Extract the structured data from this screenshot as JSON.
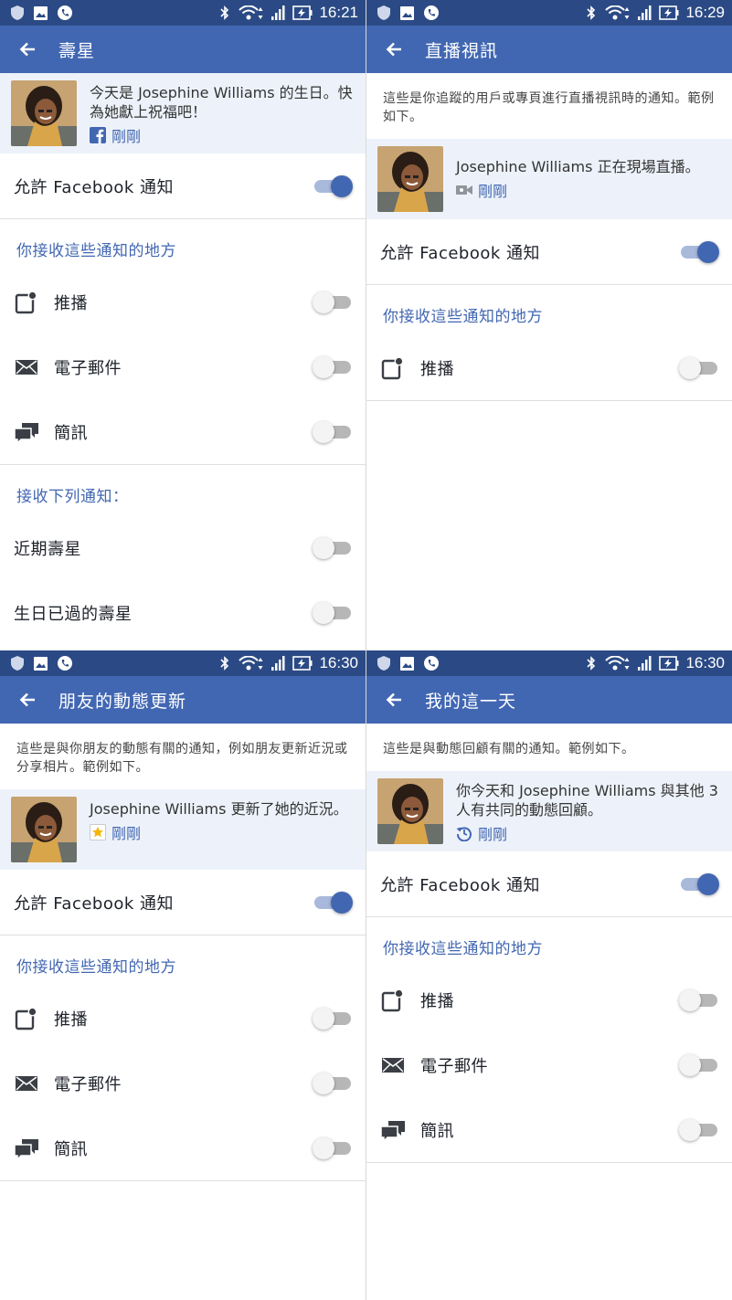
{
  "status": {
    "panels": [
      "16:21",
      "16:29",
      "16:30",
      "16:30"
    ]
  },
  "panels": [
    {
      "title": "壽星",
      "example_text": "今天是 Josephine Williams 的生日。快為她獻上祝福吧！",
      "example_time": "剛剛",
      "allow_label": "允許 Facebook 通知",
      "section_where": "你接收這些通知的地方",
      "push_label": "推播",
      "email_label": "電子郵件",
      "sms_label": "簡訊",
      "section_receive": "接收下列通知：",
      "recent_label": "近期壽星",
      "past_label": "生日已過的壽星"
    },
    {
      "title": "直播視訊",
      "description": "這些是你追蹤的用戶或專頁進行直播視訊時的通知。範例如下。",
      "example_text": "Josephine Williams 正在現場直播。",
      "example_time": "剛剛",
      "allow_label": "允許 Facebook 通知",
      "section_where": "你接收這些通知的地方",
      "push_label": "推播"
    },
    {
      "title": "朋友的動態更新",
      "description": "這些是與你朋友的動態有關的通知，例如朋友更新近況或分享相片。範例如下。",
      "example_text": "Josephine Williams 更新了她的近況。",
      "example_time": "剛剛",
      "allow_label": "允許 Facebook 通知",
      "section_where": "你接收這些通知的地方",
      "push_label": "推播",
      "email_label": "電子郵件",
      "sms_label": "簡訊"
    },
    {
      "title": "我的這一天",
      "description": "這些是與動態回顧有關的通知。範例如下。",
      "example_text": "你今天和 Josephine Williams 與其他 3 人有共同的動態回顧。",
      "example_time": "剛剛",
      "allow_label": "允許 Facebook 通知",
      "section_where": "你接收這些通知的地方",
      "push_label": "推播",
      "email_label": "電子郵件",
      "sms_label": "簡訊"
    }
  ],
  "toggles": {
    "allow_facebook": "on",
    "push": "off",
    "email": "off",
    "sms": "off",
    "recent_birthdays": "off",
    "past_birthdays": "off"
  },
  "colors": {
    "status_bar": "#2b4a85",
    "app_bar": "#4267b2",
    "example_bg": "#edf2fa",
    "accent": "#4267b2"
  },
  "icons": {
    "back": "arrow-left-icon",
    "push": "push-notification-icon",
    "email": "envelope-icon",
    "sms": "chat-bubbles-icon",
    "facebook": "facebook-logo-icon",
    "live": "video-camera-icon",
    "update": "star-icon",
    "memories": "history-clock-icon"
  }
}
